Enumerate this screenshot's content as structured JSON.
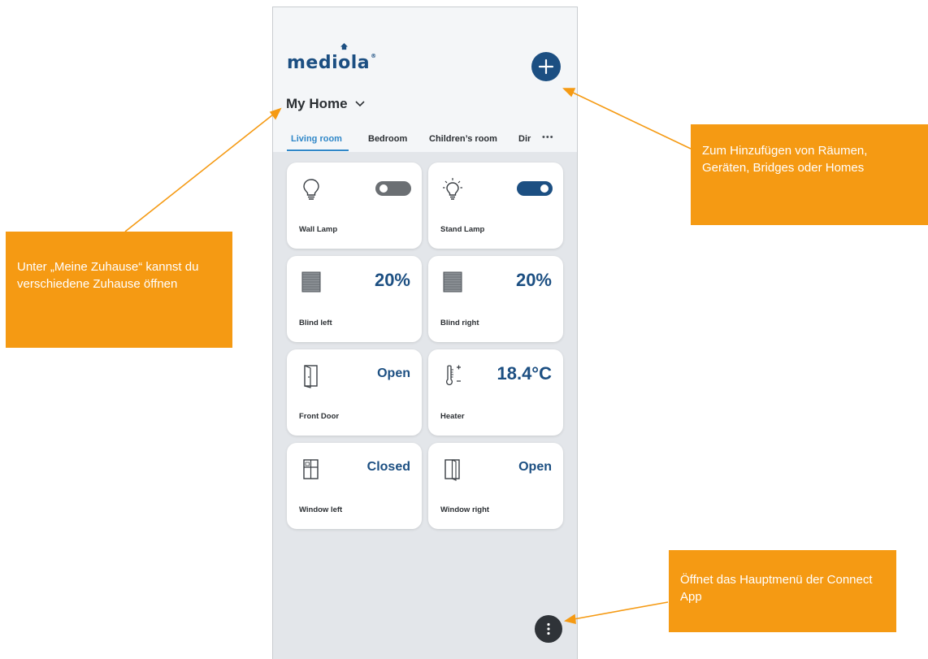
{
  "app": {
    "logo_text": "mediola",
    "logo_mark": "®",
    "home_name": "My Home"
  },
  "tabs": [
    {
      "label": "Living room",
      "active": true
    },
    {
      "label": "Bedroom",
      "active": false
    },
    {
      "label": "Children’s room",
      "active": false
    },
    {
      "label": "Dir",
      "active": false
    }
  ],
  "tabs_more": "•••",
  "devices": [
    {
      "name": "Wall Lamp",
      "icon": "bulb-off-icon",
      "toggle_on": false
    },
    {
      "name": "Stand Lamp",
      "icon": "bulb-on-icon",
      "toggle_on": true
    },
    {
      "name": "Blind left",
      "icon": "blind-icon",
      "value": "20%"
    },
    {
      "name": "Blind right",
      "icon": "blind-icon",
      "value": "20%"
    },
    {
      "name": "Front Door",
      "icon": "door-icon",
      "value": "Open"
    },
    {
      "name": "Heater",
      "icon": "thermometer-icon",
      "value": "18.4°C"
    },
    {
      "name": "Window left",
      "icon": "window-closed-icon",
      "value": "Closed"
    },
    {
      "name": "Window right",
      "icon": "window-open-icon",
      "value": "Open"
    }
  ],
  "callouts": {
    "homes": "Unter „Meine Zuhause“ kannst du verschiedene Zuhause öffnen",
    "add": "Zum Hinzufügen von Räumen, Geräten, Bridges oder Homes",
    "menu": "Öffnet das Hauptmenü der Connect App"
  },
  "colors": {
    "brand": "#1c4f82",
    "accent": "#2f87c8",
    "callout": "#f59a13",
    "toggle_off": "#6b6f73"
  }
}
